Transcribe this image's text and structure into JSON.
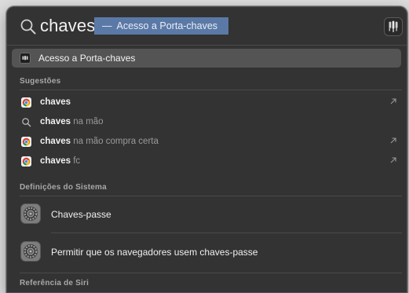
{
  "search": {
    "query": "chaves",
    "completion_dash": "—",
    "completion_text": "Acesso a Porta-chaves",
    "app_icon": "keychain-icon"
  },
  "top_hit": {
    "label": "Acesso a Porta-chaves",
    "icon": "keychain-icon"
  },
  "sections": {
    "suggestions": "Sugestões",
    "system_settings": "Definições do Sistema",
    "siri": "Referência de Siri"
  },
  "suggestions": [
    {
      "bold": "chaves",
      "rest": "",
      "icon": "chrome-icon",
      "arrow": true
    },
    {
      "bold": "chaves",
      "rest": " na mão",
      "icon": "search-icon",
      "arrow": false
    },
    {
      "bold": "chaves",
      "rest": " na mão compra certa",
      "icon": "chrome-icon",
      "arrow": true
    },
    {
      "bold": "chaves",
      "rest": " fc",
      "icon": "chrome-icon",
      "arrow": true
    }
  ],
  "system_settings": [
    {
      "label": "Chaves-passe",
      "icon": "system-settings-icon"
    },
    {
      "label": "Permitir que os navegadores usem chaves-passe",
      "icon": "system-settings-icon"
    }
  ],
  "colors": {
    "panel": "#333333",
    "selection": "#545454",
    "completion": "#5b79a6",
    "section_text": "#a8a8a8",
    "muted_text": "#9a9a9a"
  }
}
